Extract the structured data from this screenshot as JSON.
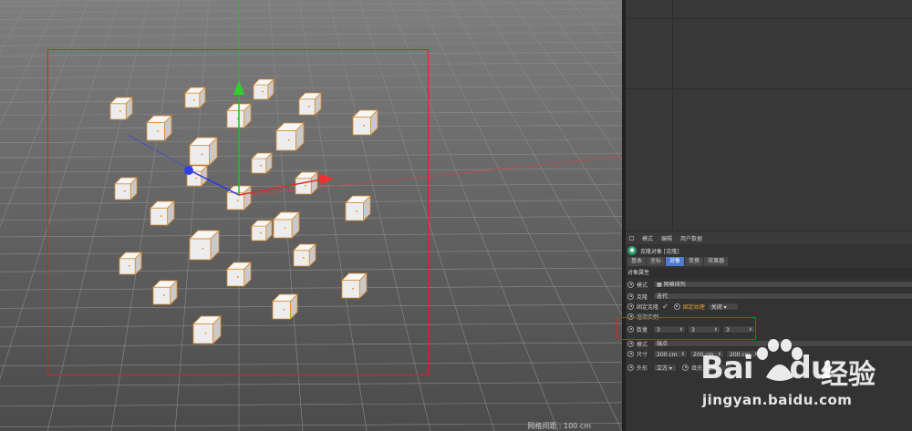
{
  "menubar": {
    "items": [
      "模式",
      "编辑",
      "用户数据"
    ]
  },
  "object": {
    "title": "克隆对象 [克隆]",
    "icon": "cloner-icon"
  },
  "tabs": [
    {
      "label": "基本",
      "active": false
    },
    {
      "label": "坐标",
      "active": false
    },
    {
      "label": "对象",
      "active": true
    },
    {
      "label": "变换",
      "active": false
    },
    {
      "label": "效果器",
      "active": false
    }
  ],
  "section": {
    "title": "对象属性"
  },
  "fields": {
    "mode": {
      "label": "模式",
      "value": "网格排列"
    },
    "clone": {
      "label": "克隆",
      "value": "迭代"
    },
    "fixed_clone": {
      "label": "固定克隆",
      "checked": "✓"
    },
    "fixed_texture": {
      "label": "固定纹理",
      "value": "关闭"
    },
    "render_instances": {
      "label": "渲染实例"
    },
    "count": {
      "label": "数量",
      "x": "3",
      "y": "3",
      "z": "3"
    },
    "mode2": {
      "label": "模式",
      "value": "端点"
    },
    "size": {
      "label": "尺寸",
      "x": "200 cm",
      "y": "200 cm",
      "z": "200 cm"
    },
    "shape": {
      "label": "外形",
      "value": "立方"
    },
    "fill": {
      "label": "填充",
      "value": "10"
    }
  },
  "viewport": {
    "status": "网格间距 : 100 cm"
  },
  "watermark": {
    "brand": "Bai",
    "brand2": "du",
    "suffix": "经验",
    "url": "jingyan.baidu.com"
  }
}
